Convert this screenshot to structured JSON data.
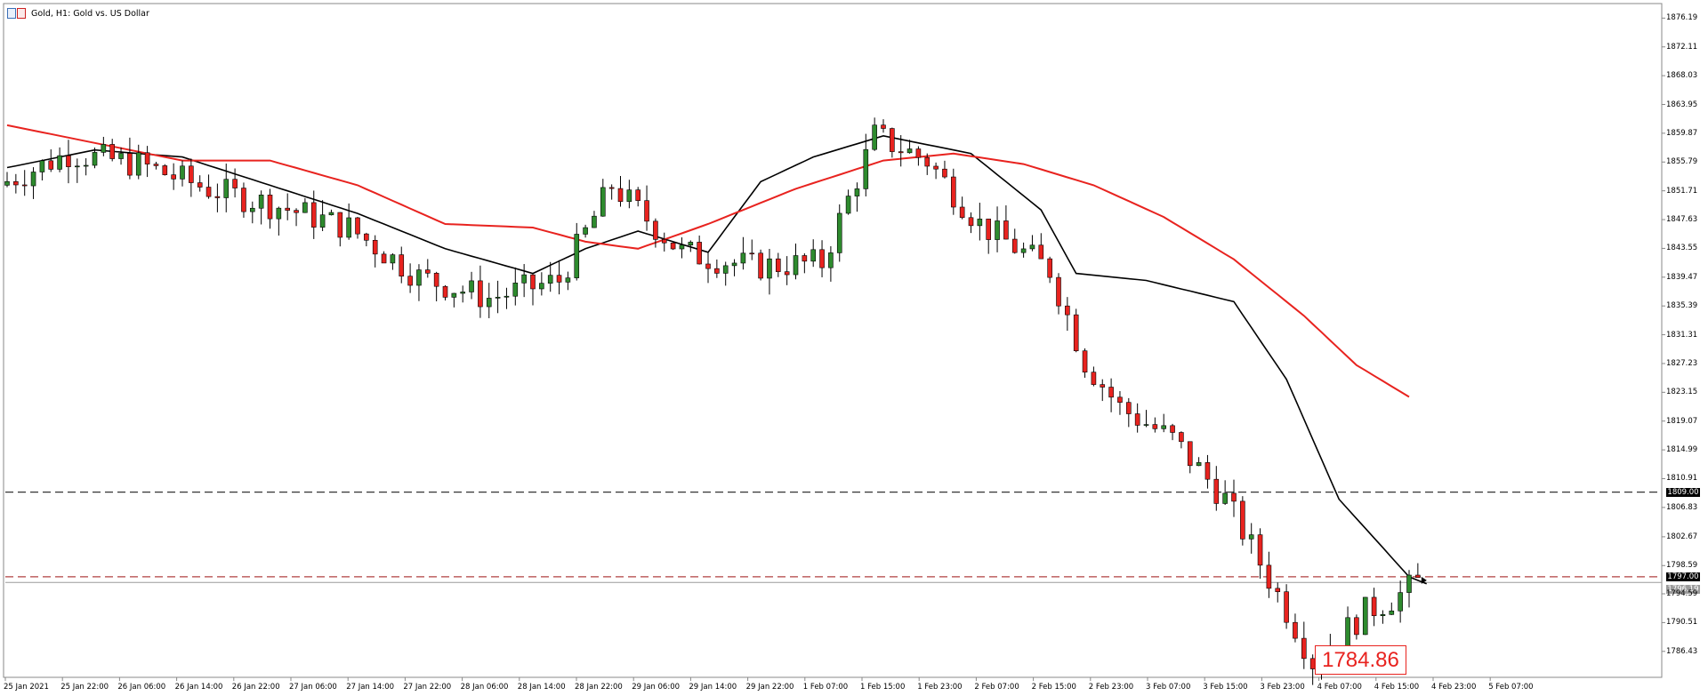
{
  "header": {
    "title": "Gold, H1:  Gold vs. US Dollar"
  },
  "price_callout": "1784.86",
  "levels": {
    "resistance_label": "1809.00",
    "support_label": "1797.00",
    "current_label": "1796.19"
  },
  "colors": {
    "bull": "#2e8b2e",
    "bear": "#e8231f",
    "ma_fast": "#000000",
    "ma_slow": "#e8231f",
    "level_line": "#333333",
    "support_line": "#b04040"
  },
  "chart_data": {
    "type": "candlestick",
    "symbol": "Gold",
    "timeframe": "H1",
    "ylim": [
      1783.0,
      1878.0
    ],
    "y_ticks": [
      "1876.19",
      "1872.11",
      "1868.03",
      "1863.95",
      "1859.87",
      "1855.79",
      "1851.71",
      "1847.63",
      "1843.55",
      "1839.47",
      "1835.39",
      "1831.31",
      "1827.23",
      "1823.15",
      "1819.07",
      "1814.99",
      "1810.91",
      "1806.83",
      "1802.67",
      "1798.59",
      "1794.59",
      "1790.51",
      "1786.43"
    ],
    "x_ticks": [
      "25 Jan 2021",
      "25 Jan 22:00",
      "26 Jan 06:00",
      "26 Jan 14:00",
      "26 Jan 22:00",
      "27 Jan 06:00",
      "27 Jan 14:00",
      "27 Jan 22:00",
      "28 Jan 06:00",
      "28 Jan 14:00",
      "28 Jan 22:00",
      "29 Jan 06:00",
      "29 Jan 14:00",
      "29 Jan 22:00",
      "1 Feb 07:00",
      "1 Feb 15:00",
      "1 Feb 23:00",
      "2 Feb 07:00",
      "2 Feb 15:00",
      "2 Feb 23:00",
      "3 Feb 07:00",
      "3 Feb 15:00",
      "3 Feb 23:00",
      "4 Feb 07:00",
      "4 Feb 15:00",
      "4 Feb 23:00",
      "5 Feb 07:00"
    ],
    "horizontal_levels": [
      1809.0,
      1797.0
    ],
    "candle_anchors": [
      [
        0,
        1852.5
      ],
      [
        8,
        1857.0
      ],
      [
        16,
        1855.5
      ],
      [
        24,
        1852.0
      ],
      [
        32,
        1849.5
      ],
      [
        40,
        1846.5
      ],
      [
        48,
        1839.5
      ],
      [
        56,
        1836.5
      ],
      [
        64,
        1839.0
      ],
      [
        70,
        1852.5
      ],
      [
        78,
        1843.0
      ],
      [
        86,
        1841.0
      ],
      [
        94,
        1841.5
      ],
      [
        100,
        1859.5
      ],
      [
        106,
        1856.0
      ],
      [
        112,
        1847.0
      ],
      [
        120,
        1840.5
      ],
      [
        124,
        1827.5
      ],
      [
        128,
        1821.0
      ],
      [
        134,
        1816.5
      ],
      [
        140,
        1808.0
      ],
      [
        148,
        1790.0
      ],
      [
        150,
        1785.0
      ],
      [
        156,
        1792.0
      ],
      [
        160,
        1794.5
      ],
      [
        162,
        1796.2
      ]
    ],
    "candle_count": 162,
    "series": [
      {
        "name": "MA fast",
        "style": "black line",
        "anchors": [
          [
            0,
            1855.0
          ],
          [
            10,
            1857.5
          ],
          [
            20,
            1856.5
          ],
          [
            30,
            1852.5
          ],
          [
            40,
            1848.5
          ],
          [
            50,
            1843.5
          ],
          [
            60,
            1840.0
          ],
          [
            66,
            1843.5
          ],
          [
            72,
            1846.0
          ],
          [
            80,
            1843.0
          ],
          [
            86,
            1853.0
          ],
          [
            92,
            1856.5
          ],
          [
            100,
            1859.5
          ],
          [
            110,
            1857.0
          ],
          [
            118,
            1849.0
          ],
          [
            122,
            1840.0
          ],
          [
            130,
            1839.0
          ],
          [
            140,
            1836.0
          ],
          [
            146,
            1825.0
          ],
          [
            152,
            1808.0
          ],
          [
            160,
            1797.0
          ],
          [
            162,
            1796.0
          ]
        ]
      },
      {
        "name": "MA slow",
        "style": "red line",
        "anchors": [
          [
            0,
            1861.0
          ],
          [
            10,
            1858.5
          ],
          [
            20,
            1856.0
          ],
          [
            30,
            1856.0
          ],
          [
            40,
            1852.5
          ],
          [
            50,
            1847.0
          ],
          [
            60,
            1846.5
          ],
          [
            66,
            1844.5
          ],
          [
            72,
            1843.5
          ],
          [
            80,
            1847.0
          ],
          [
            90,
            1852.0
          ],
          [
            100,
            1856.0
          ],
          [
            108,
            1857.0
          ],
          [
            116,
            1855.5
          ],
          [
            124,
            1852.5
          ],
          [
            132,
            1848.0
          ],
          [
            140,
            1842.0
          ],
          [
            148,
            1834.0
          ],
          [
            154,
            1827.0
          ],
          [
            160,
            1822.5
          ]
        ]
      }
    ]
  }
}
